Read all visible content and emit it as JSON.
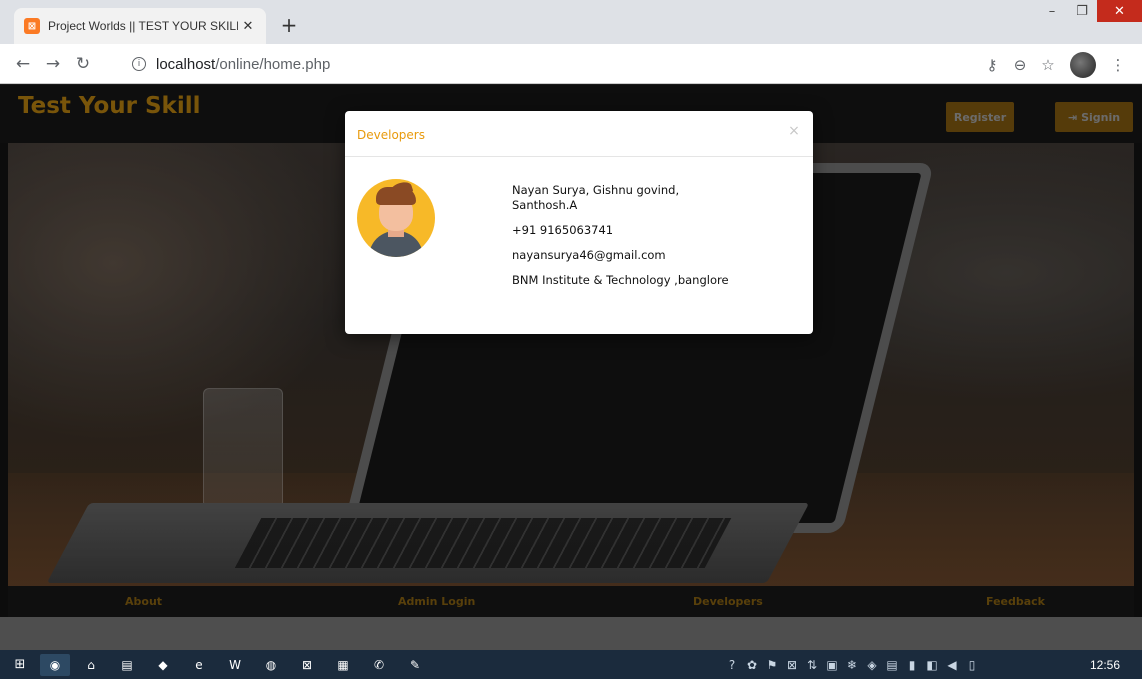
{
  "browser": {
    "tab_title": "Project Worlds || TEST YOUR SKILL",
    "favicon_glyph": "⊠",
    "tab_close": "✕",
    "new_tab": "+",
    "url_host": "localhost",
    "url_path": "/online/home.php",
    "window_controls": {
      "minimize": "–",
      "maximize": "❐",
      "close": "✕"
    },
    "nav": {
      "back": "←",
      "forward": "→",
      "reload": "↻",
      "info": "i"
    },
    "toolbar_icons": {
      "key": "⚷",
      "zoom": "⊖",
      "star": "☆",
      "menu": "⋮"
    }
  },
  "site": {
    "brand": "Test Your Skill",
    "register_label": "Register",
    "signin_label": "Signin",
    "signin_icon": "⇥",
    "footer_nav": [
      "About",
      "Admin Login",
      "Developers",
      "Feedback"
    ]
  },
  "modal": {
    "title": "Developers",
    "close": "×",
    "names": "Nayan Surya, Gishnu govind, Santhosh.A",
    "phone": "+91 9165063741",
    "email": "nayansurya46@gmail.com",
    "institute": "BNM Institute & Technology ,banglore"
  },
  "taskbar": {
    "start": "⊞",
    "clock": "12:56",
    "apps": [
      "chrome",
      "home",
      "files",
      "app",
      "ie",
      "word",
      "firefox",
      "xampp",
      "notepad",
      "whatsapp",
      "tool"
    ],
    "app_glyphs": [
      "◉",
      "⌂",
      "▤",
      "◆",
      "e",
      "W",
      "◍",
      "⊠",
      "▦",
      "✆",
      "✎"
    ],
    "tray_glyphs": [
      "?",
      "✿",
      "⚑",
      "⊠",
      "⇅",
      "▣",
      "❄",
      "◈",
      "▤",
      "▮",
      "◧",
      "◀",
      "▯"
    ]
  },
  "colors": {
    "brand": "#a8770e",
    "button": "#c8860a",
    "modal_title": "#e89a0c",
    "avatar_bg": "#f7b928"
  }
}
